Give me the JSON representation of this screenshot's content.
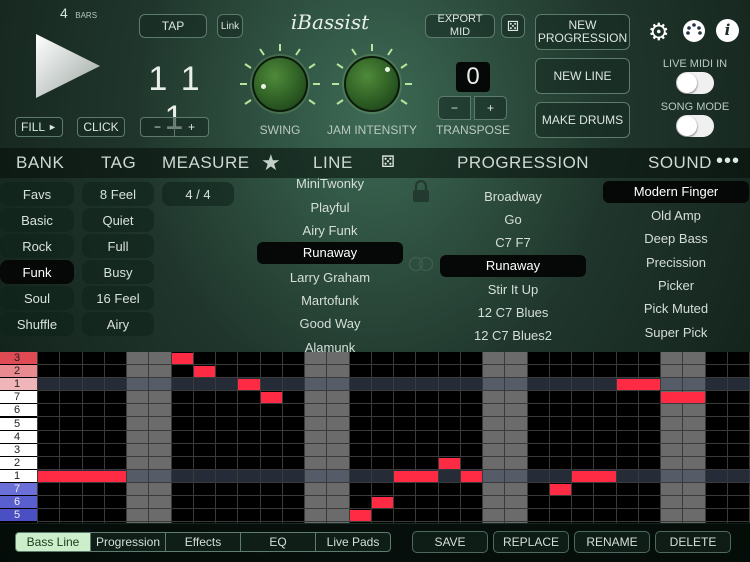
{
  "top": {
    "bars_count": "4",
    "bars_label": "BARS",
    "fill_label": "FILL",
    "click_label": "CLICK",
    "tap_label": "TAP",
    "link_label": "Link",
    "beat_display": "1 1 1",
    "minus": "−",
    "plus": "+",
    "logo_text": "iBassist",
    "swing_label": "SWING",
    "jam_intensity_label": "JAM INTENSITY",
    "export_label": "EXPORT MID",
    "transpose_value": "0",
    "transpose_label": "TRANSPOSE",
    "new_progression_label": "NEW\nPROGRESSION",
    "new_line_label": "NEW LINE",
    "make_drums_label": "MAKE DRUMS",
    "live_midi_label": "LIVE MIDI IN",
    "song_mode_label": "SONG MODE"
  },
  "headers": {
    "bank": "BANK",
    "tag": "TAG",
    "measure": "MEASURE",
    "line": "LINE",
    "progression": "PROGRESSION",
    "sound": "SOUND"
  },
  "banks": [
    "Favs",
    "Basic",
    "Rock",
    "Funk",
    "Soul",
    "Shuffle"
  ],
  "bank_selected": 3,
  "tags": [
    "8 Feel",
    "Quiet",
    "Full",
    "Busy",
    "16 Feel",
    "Airy"
  ],
  "measure_value": "4 / 4",
  "lines": [
    "MiniTwonky",
    "Playful",
    "Airy Funk",
    "Runaway",
    "Larry Graham",
    "Martofunk",
    "Good Way",
    "Alamunk"
  ],
  "line_selected": 3,
  "progressions": [
    "Broadway",
    "Go",
    "C7 F7",
    "Runaway",
    "Stir It Up",
    "12 C7 Blues",
    "12 C7 Blues2"
  ],
  "progression_selected": 3,
  "sounds": [
    "Modern Finger",
    "Old Amp",
    "Deep Bass",
    "Precission",
    "Picker",
    "Pick Muted",
    "Super Pick"
  ],
  "sound_selected": 0,
  "grid_rows": [
    "3",
    "2",
    "1",
    "7",
    "6",
    "5",
    "4",
    "3",
    "2",
    "1",
    "7",
    "6",
    "5"
  ],
  "grid_notes": [
    {
      "row": 0,
      "col": 6,
      "len": 1
    },
    {
      "row": 1,
      "col": 7,
      "len": 1
    },
    {
      "row": 2,
      "col": 9,
      "len": 1
    },
    {
      "row": 2,
      "col": 26,
      "len": 2
    },
    {
      "row": 3,
      "col": 10,
      "len": 1
    },
    {
      "row": 3,
      "col": 28,
      "len": 2
    },
    {
      "row": 8,
      "col": 18,
      "len": 1
    },
    {
      "row": 9,
      "col": 0,
      "len": 4
    },
    {
      "row": 9,
      "col": 16,
      "len": 2
    },
    {
      "row": 9,
      "col": 19,
      "len": 1
    },
    {
      "row": 9,
      "col": 24,
      "len": 2
    },
    {
      "row": 10,
      "col": 23,
      "len": 1
    },
    {
      "row": 11,
      "col": 15,
      "len": 1
    },
    {
      "row": 12,
      "col": 14,
      "len": 1
    }
  ],
  "tabs": [
    "Bass Line",
    "Progression",
    "Effects",
    "EQ",
    "Live Pads"
  ],
  "tab_selected": 0,
  "actions": [
    "SAVE",
    "REPLACE",
    "RENAME",
    "DELETE"
  ]
}
